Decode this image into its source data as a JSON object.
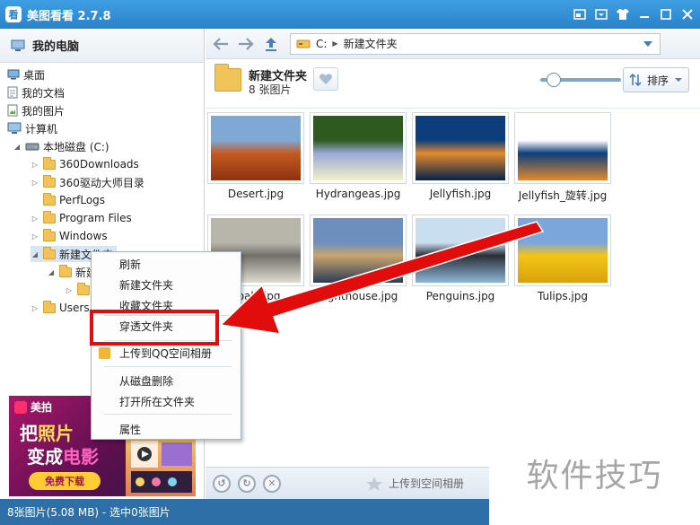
{
  "window": {
    "app_title": "美图看看 2.7.8"
  },
  "sidebar": {
    "header_label": "我的电脑",
    "tree": [
      {
        "label": "桌面",
        "icon": "desktop-icon"
      },
      {
        "label": "我的文档",
        "icon": "documents-icon"
      },
      {
        "label": "我的图片",
        "icon": "pictures-icon"
      },
      {
        "label": "计算机",
        "icon": "computer-icon"
      },
      {
        "label": "本地磁盘 (C:)",
        "icon": "disk-icon"
      },
      {
        "label": "360Downloads",
        "icon": "folder-icon"
      },
      {
        "label": "360驱动大师目录",
        "icon": "folder-icon"
      },
      {
        "label": "PerfLogs",
        "icon": "folder-icon"
      },
      {
        "label": "Program Files",
        "icon": "folder-icon"
      },
      {
        "label": "Windows",
        "icon": "folder-icon"
      },
      {
        "label": "新建文件夹",
        "icon": "folder-icon"
      },
      {
        "label": "新建",
        "icon": "folder-icon"
      },
      {
        "label": "",
        "icon": "folder-icon"
      },
      {
        "label": "Users",
        "icon": "folder-icon"
      }
    ]
  },
  "ad": {
    "brand": "美拍",
    "line1_a": "把",
    "line1_b": "照片",
    "line2_a": "变成",
    "line2_b": "电影",
    "cta": "免费下载"
  },
  "address_bar": {
    "drive": "C:",
    "folder": "新建文件夹"
  },
  "folder": {
    "name": "新建文件夹",
    "count": "8 张图片"
  },
  "sort_label": "排序",
  "zoom_level": 0.08,
  "images": [
    {
      "name": "Desert.jpg",
      "colors": [
        "#7fa9d4",
        "#c55a22",
        "#8d3210"
      ]
    },
    {
      "name": "Hydrangeas.jpg",
      "colors": [
        "#2f5a1d",
        "#9aa9d8",
        "#f1f1c7"
      ]
    },
    {
      "name": "Jellyfish.jpg",
      "colors": [
        "#0b3e7a",
        "#e48a2d",
        "#04224a"
      ]
    },
    {
      "name": "Jellyfish_旋转.jpg",
      "colors": [
        "#ffffff",
        "#0c3e7d",
        "#e48a2d"
      ]
    },
    {
      "name": "Koala.jpg",
      "colors": [
        "#b8b6ab",
        "#72706a",
        "#e0dcd0"
      ]
    },
    {
      "name": "Lighthouse.jpg",
      "colors": [
        "#6d8fbd",
        "#c9a56f",
        "#2c3c57"
      ]
    },
    {
      "name": "Penguins.jpg",
      "colors": [
        "#c9dff0",
        "#2a2e35",
        "#8fb6d9"
      ]
    },
    {
      "name": "Tulips.jpg",
      "colors": [
        "#7aa6dc",
        "#f4c516",
        "#d9a10d"
      ]
    }
  ],
  "context_menu": {
    "items": [
      "刷新",
      "新建文件夹",
      "收藏文件夹",
      "穿透文件夹",
      "上传到QQ空间相册",
      "从磁盘删除",
      "打开所在文件夹",
      "属性"
    ]
  },
  "bottom_bar": {
    "upload_label": "上传到空间相册"
  },
  "status": {
    "text": "8张图片(5.08 MB) - 选中0张图片"
  },
  "watermark": "软件技巧",
  "colors": {
    "titlebar": "#2a82c8",
    "highlight": "#e10d0d",
    "statusbar": "#2f6fa8"
  }
}
